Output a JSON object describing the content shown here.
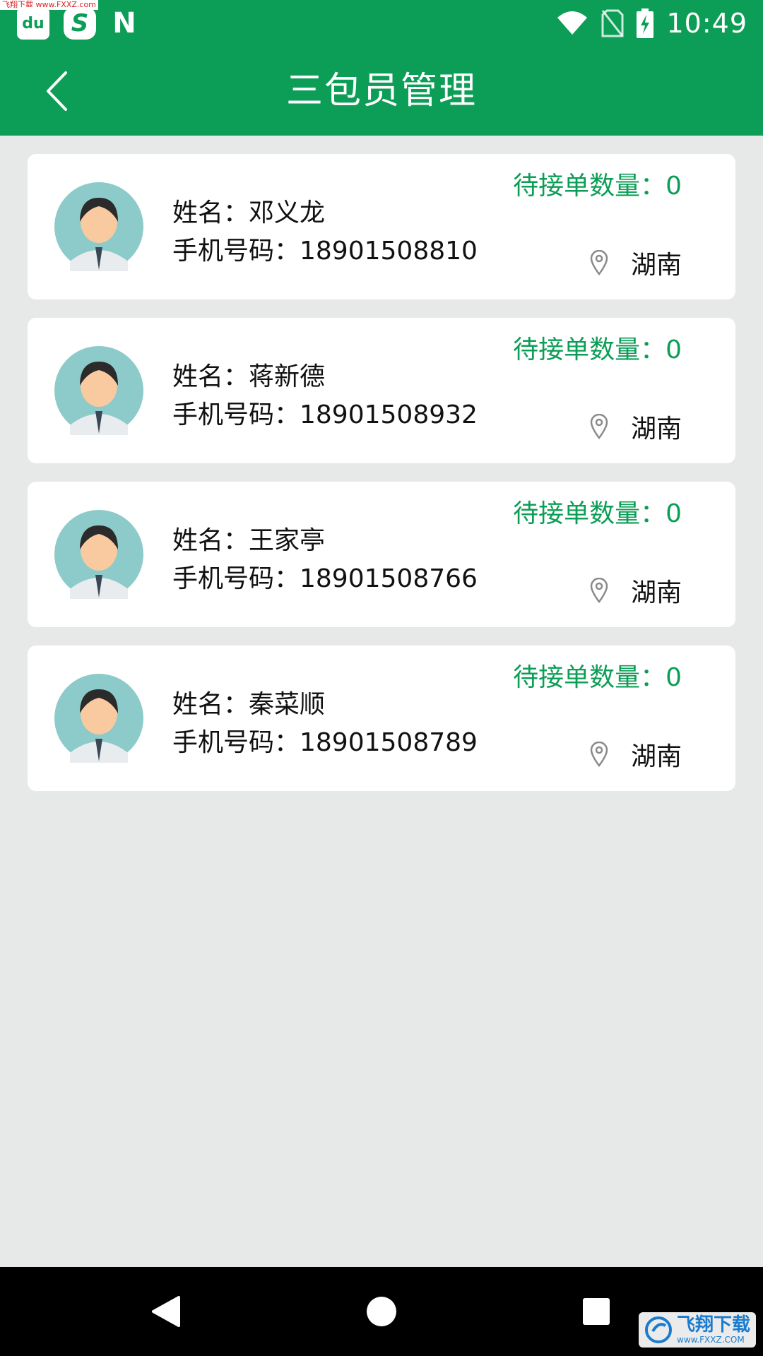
{
  "status_bar": {
    "time": "10:49",
    "watermark": "飞翔下载 www.FXXZ.com",
    "left_icons": [
      "du-app-icon",
      "s-app-icon",
      "n-app-icon"
    ],
    "app_labels": {
      "du": "du",
      "s": "S",
      "n": "N"
    },
    "right_icons": [
      "wifi-icon",
      "no-sim-icon",
      "battery-charging-icon"
    ]
  },
  "header": {
    "title": "三包员管理",
    "back_icon": "chevron-left-icon"
  },
  "colors": {
    "brand_green": "#0c9d56",
    "background": "#e6e9e8",
    "card": "#ffffff",
    "avatar_bg": "#8ccbc9"
  },
  "members": [
    {
      "name_label": "姓名：邓义龙",
      "phone_label": "手机号码：18901508810",
      "pending_label": "待接单数量：0",
      "location": "湖南"
    },
    {
      "name_label": "姓名：蒋新德",
      "phone_label": "手机号码：18901508932",
      "pending_label": "待接单数量：0",
      "location": "湖南"
    },
    {
      "name_label": "姓名：王家亭",
      "phone_label": "手机号码：18901508766",
      "pending_label": "待接单数量：0",
      "location": "湖南"
    },
    {
      "name_label": "姓名：秦菜顺",
      "phone_label": "手机号码：18901508789",
      "pending_label": "待接单数量：0",
      "location": "湖南"
    }
  ],
  "nav_bar": {
    "icons": [
      "back-triangle-icon",
      "home-circle-icon",
      "recents-square-icon"
    ]
  },
  "watermark_bottom": {
    "title": "飞翔下载",
    "url": "www.FXXZ.COM"
  }
}
